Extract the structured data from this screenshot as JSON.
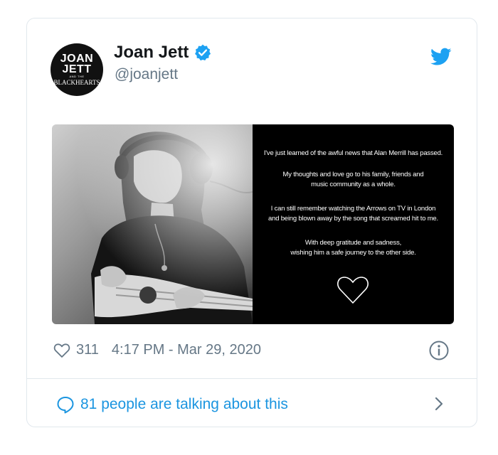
{
  "tweet": {
    "author": {
      "name": "Joan Jett",
      "handle": "@joanjett",
      "avatar_text": [
        "JOAN",
        "JETT",
        "AND THE",
        "BLACKHEARTS"
      ]
    },
    "media": {
      "photo_desc": "photo",
      "paragraphs": [
        "I've just learned of the awful news that Alan Merrill has passed.",
        "My thoughts and love go to his family, friends and",
        "music community as a whole.",
        "I can still remember watching the Arrows on TV in London",
        "and being blown away by the song that screamed hit to me.",
        "With deep gratitude and sadness,",
        "wishing him a safe journey to the other side."
      ]
    },
    "likes": "311",
    "timestamp": "4:17 PM - Mar 29, 2020",
    "talking": "81 people are talking about this"
  },
  "colors": {
    "twitter_blue": "#1da1f2",
    "link_blue": "#1b95e0",
    "gray_text": "#657786",
    "divider": "#e1e8ed"
  },
  "icons": {
    "verified": "verified-badge-icon",
    "bird": "twitter-bird-icon",
    "like": "heart-outline-icon",
    "info": "info-circle-icon",
    "reply": "speech-bubble-icon",
    "chevron": "chevron-right-icon"
  }
}
